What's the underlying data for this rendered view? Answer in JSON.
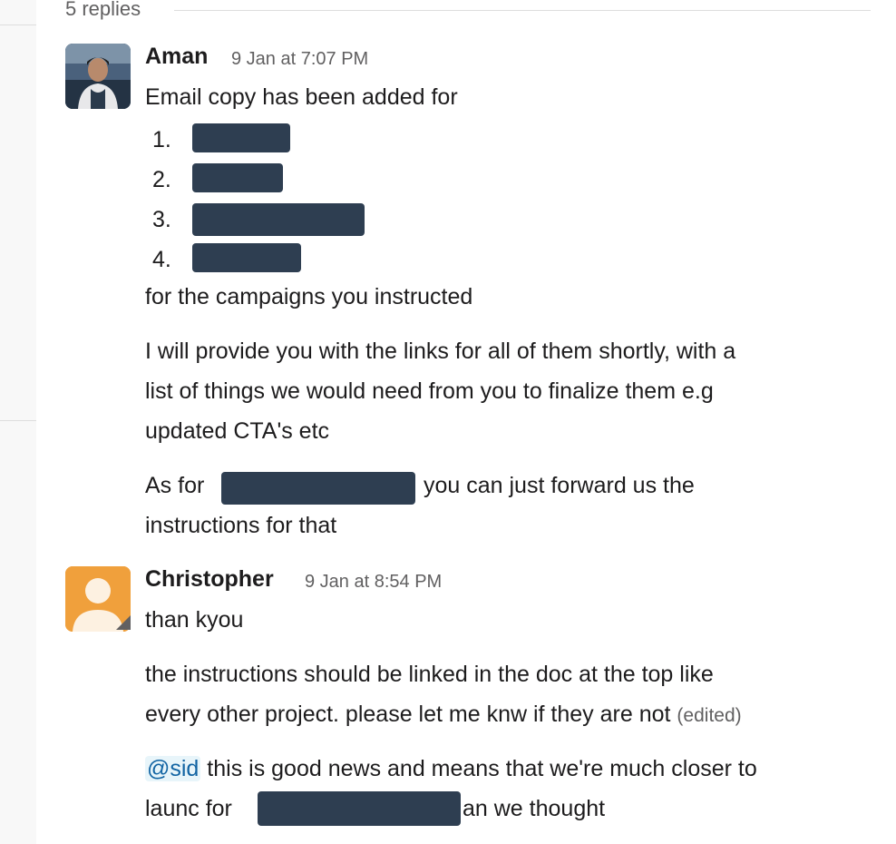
{
  "thread": {
    "replies_label": "5 replies"
  },
  "messages": [
    {
      "sender": "Aman",
      "timestamp": "9 Jan at 7:07 PM",
      "intro": "Email copy has been added for",
      "list_numbers": [
        "1.",
        "2.",
        "3.",
        "4."
      ],
      "line_after_list": "for the campaigns you instructed",
      "para2_line1": "I will provide you with the links for all of them shortly, with a",
      "para2_line2": "list of things we would need from you to finalize them e.g",
      "para2_line3": "updated CTA's etc",
      "para3_prefix": "As for",
      "para3_suffix": "you can just forward us the",
      "para3_line2": "instructions for that"
    },
    {
      "sender": "Christopher",
      "timestamp": "9 Jan at 8:54 PM",
      "line1": "than kyou",
      "para2_line1": "the instructions should be linked in the doc at the top like",
      "para2_line2": "every other project. please let me knw if they are not",
      "edited_label": "(edited)",
      "mention": "@sid",
      "para3_line1_rest": "this is good news and means that we're much closer to",
      "para3_line2_prefix": "launc for",
      "para3_line2_suffix": "an we thought"
    }
  ]
}
